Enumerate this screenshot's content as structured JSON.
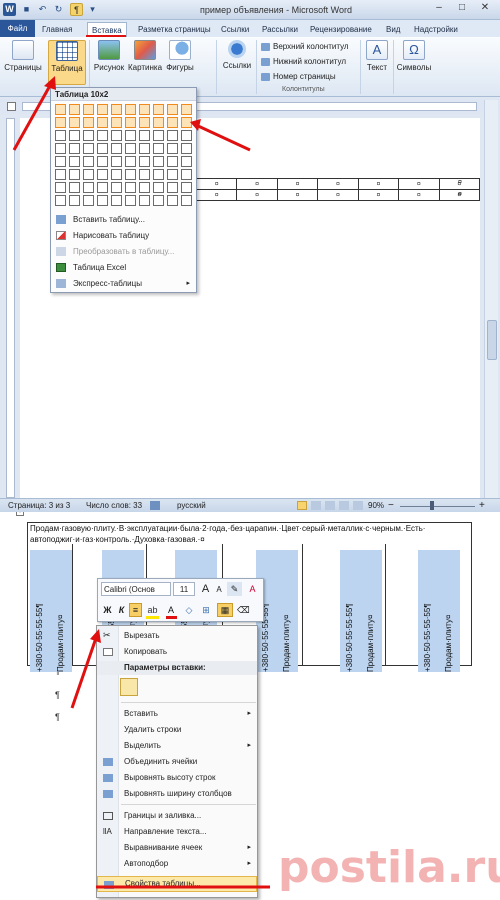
{
  "window": {
    "title": "пример объявления - Microsoft Word"
  },
  "tabs": [
    "Файл",
    "Главная",
    "Вставка",
    "Разметка страницы",
    "Ссылки",
    "Рассылки",
    "Рецензирование",
    "Вид",
    "Надстройки"
  ],
  "ribbon": {
    "pages_label": "Страницы",
    "table_label": "Таблица",
    "picture_label": "Рисунок",
    "clipart_label": "Картинка",
    "shapes_label": "Фигуры",
    "links_label": "Ссылки",
    "header": "Верхний колонтитул",
    "footer": "Нижний колонтитул",
    "page_number": "Номер страницы",
    "hf_group": "Колонтитулы",
    "text_label": "Текст",
    "symbols_label": "Символы"
  },
  "table_dropdown": {
    "header": "Таблица 10x2",
    "items": [
      "Вставить таблицу...",
      "Нарисовать таблицу",
      "Преобразовать в таблицу...",
      "Таблица Excel",
      "Экспресс-таблицы"
    ]
  },
  "doc_table": {
    "cell_mark": "¤"
  },
  "statusbar": {
    "page": "Страница: 3 из 3",
    "words": "Число слов: 33",
    "lang": "русский",
    "zoom": "90%"
  },
  "document": {
    "text_line1": "Продам·газовую·плиту.·В·эксплуатации·была·2·года,·без·царапин.·Цвет·серый·металлик·с·черным.·Есть·",
    "text_line2": "автоподжиг·и·газ·контроль.·Духовка·газовая.·¤",
    "phone": "+380·50·55·55·55¶",
    "item": "Продам·плиту¤",
    "para_mark": "¶"
  },
  "mini_toolbar": {
    "font": "Calibri (Основ",
    "size": "11",
    "bold": "Ж",
    "italic": "К",
    "grow": "A",
    "shrink": "A"
  },
  "context_menu": {
    "items": [
      "Вырезать",
      "Копировать"
    ],
    "paste_header": "Параметры вставки:",
    "items2": [
      "Вставить",
      "Удалить строки",
      "Выделить",
      "Объединить ячейки",
      "Выровнять высоту строк",
      "Выровнять ширину столбцов"
    ],
    "items3": [
      "Границы и заливка...",
      "Направление текста...",
      "Выравнивание ячеек",
      "Автоподбор",
      "Свойства таблицы..."
    ]
  },
  "watermark": "postila.ru"
}
